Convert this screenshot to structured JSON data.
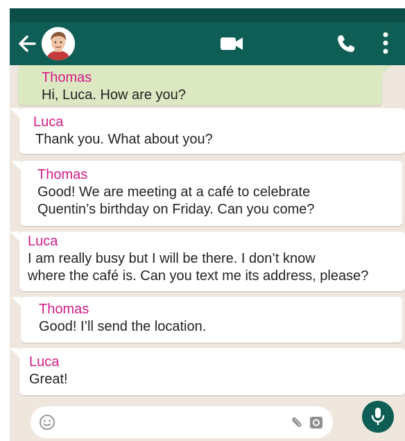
{
  "colors": {
    "header": "#0f5e55",
    "background": "#efe7dd",
    "outgoing_bubble": "#dbe8c1",
    "incoming_bubble": "#ffffff",
    "sender_name": "#d41c86"
  },
  "header": {
    "icons": [
      "back-arrow-icon",
      "contact-avatar",
      "video-call-icon",
      "voice-call-icon",
      "more-options-icon"
    ]
  },
  "messages": [
    {
      "sender": "Thomas",
      "lines": [
        "Hi, Luca. How are you?"
      ]
    },
    {
      "sender": "Luca",
      "lines": [
        "Thank you. What about you?"
      ]
    },
    {
      "sender": "Thomas",
      "lines": [
        "Good! We are meeting at a café to celebrate",
        "Quentin’s birthday on Friday. Can you come?"
      ]
    },
    {
      "sender": "Luca",
      "lines": [
        "I am really busy but I will be there. I don’t know",
        "where the café is. Can you text me its address, please?"
      ]
    },
    {
      "sender": "Thomas",
      "lines": [
        "Good! I’ll send the location."
      ]
    },
    {
      "sender": "Luca",
      "lines": [
        "Great!"
      ]
    }
  ],
  "input_bar": {
    "icons": [
      "emoji-icon",
      "attach-icon",
      "camera-icon",
      "mic-icon"
    ]
  }
}
